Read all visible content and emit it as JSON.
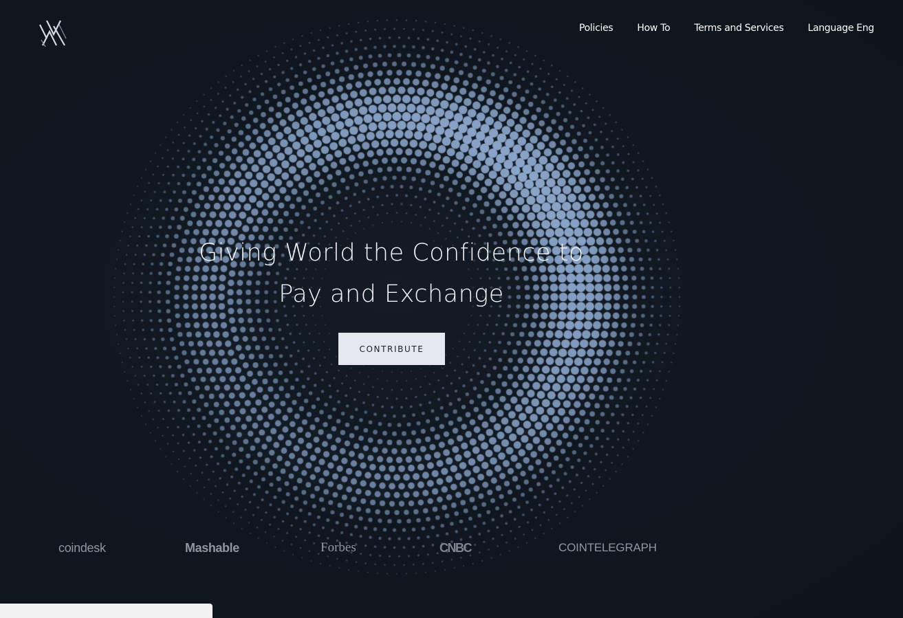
{
  "header": {
    "logo_alt": "logo",
    "nav": [
      {
        "label": "Policies"
      },
      {
        "label": "How To"
      },
      {
        "label": "Terms and Services"
      },
      {
        "label": "Language Eng"
      }
    ]
  },
  "hero": {
    "title_line1": "Giving World the Confidence to",
    "title_line2": "Pay and Exchange",
    "cta_label": "CONTRIBUTE"
  },
  "press": {
    "logos": [
      "coindesk",
      "Mashable",
      "Forbes",
      "CNBC",
      "COINTELEGRAPH"
    ]
  },
  "colors": {
    "background": "#0f151d",
    "dot": "#8ea8cc",
    "button_bg": "#e6e8f0",
    "press_text": "#8e96a2"
  }
}
